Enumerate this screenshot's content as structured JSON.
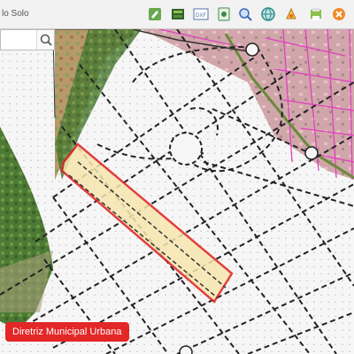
{
  "app": {
    "title_fragment": "lo Solo"
  },
  "toolbar": {
    "icons": [
      {
        "name": "edit-icon",
        "color": "#5b9b3a"
      },
      {
        "name": "layers-icon",
        "color": "#4b7f3a"
      },
      {
        "name": "scale-icon",
        "color": "#5470a8"
      },
      {
        "name": "document-icon",
        "color": "#3a8a4a"
      },
      {
        "name": "search-zoom-icon",
        "color": "#3a67b8"
      },
      {
        "name": "globe-icon",
        "color": "#2e8a8a"
      },
      {
        "name": "paint-icon",
        "color": "#d8a43a"
      },
      {
        "name": "print-icon",
        "color": "#6b9b3a"
      },
      {
        "name": "close-icon",
        "color": "#e86a1a"
      }
    ]
  },
  "search": {
    "value": "",
    "placeholder": ""
  },
  "map": {
    "highlight_color": "#e02020",
    "highlight_fill": "#f8e6b0",
    "urban_fill": "#f7f7f7",
    "vegetation_color": "#3d6a2e",
    "zone_pink": "#e6a8c8",
    "label": "Diretriz Municipal Urbana"
  }
}
